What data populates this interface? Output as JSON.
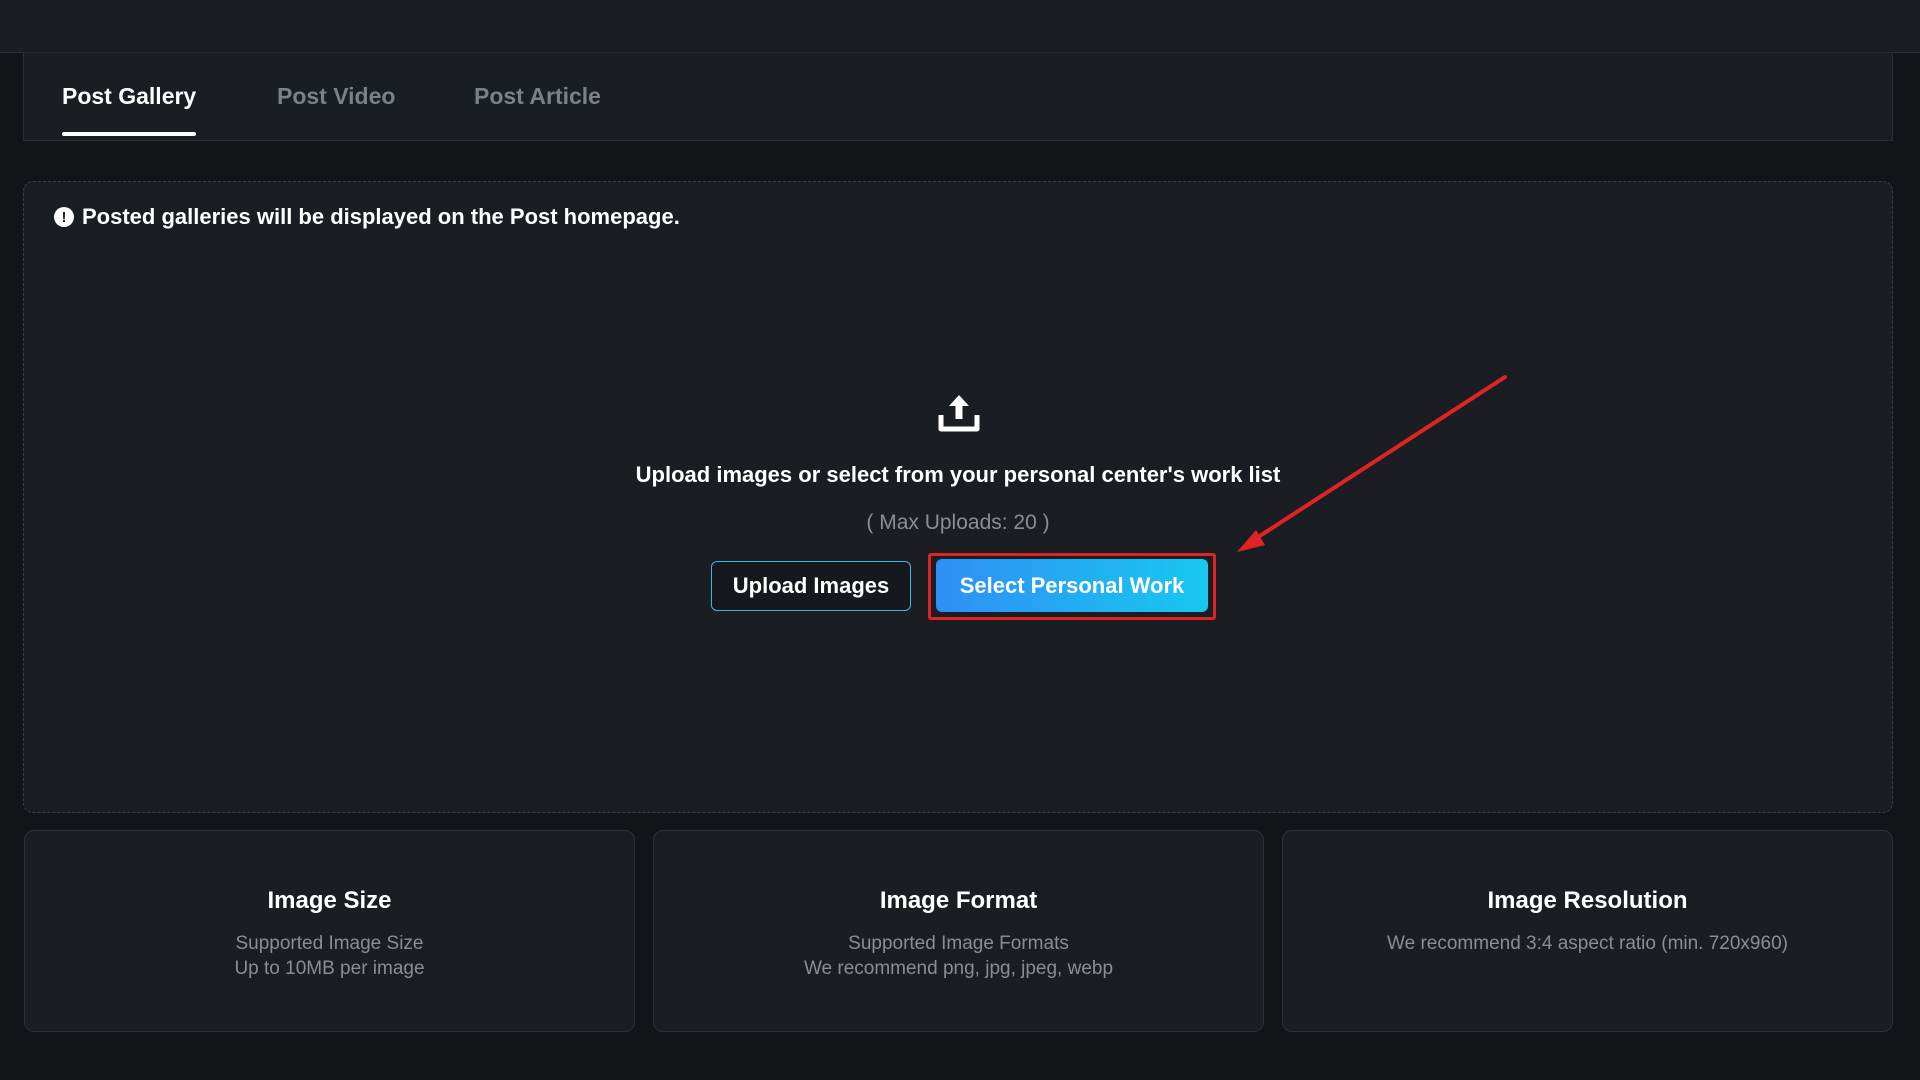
{
  "tabs": [
    {
      "label": "Post Gallery",
      "active": true
    },
    {
      "label": "Post Video",
      "active": false
    },
    {
      "label": "Post Article",
      "active": false
    }
  ],
  "notice": {
    "icon": "info-icon",
    "text": "Posted galleries will be displayed on the Post homepage."
  },
  "upload": {
    "icon": "upload-icon",
    "title": "Upload images or select from your personal center's work list",
    "max_text": "( Max Uploads: 20 )",
    "upload_button": "Upload Images",
    "select_button": "Select Personal Work"
  },
  "info_cards": [
    {
      "title": "Image Size",
      "line1": "Supported Image Size",
      "line2": "Up to 10MB per image"
    },
    {
      "title": "Image Format",
      "line1": "Supported Image Formats",
      "line2": "We recommend png, jpg, jpeg, webp"
    },
    {
      "title": "Image Resolution",
      "line1": "We recommend 3:4 aspect ratio (min. 720x960)",
      "line2": ""
    }
  ],
  "colors": {
    "background": "#121417",
    "panel": "#1a1d21",
    "accent_gradient_start": "#2f8ff5",
    "accent_gradient_end": "#18c8f0",
    "annotation_red": "#e02424",
    "muted_text": "#8a8e94"
  }
}
